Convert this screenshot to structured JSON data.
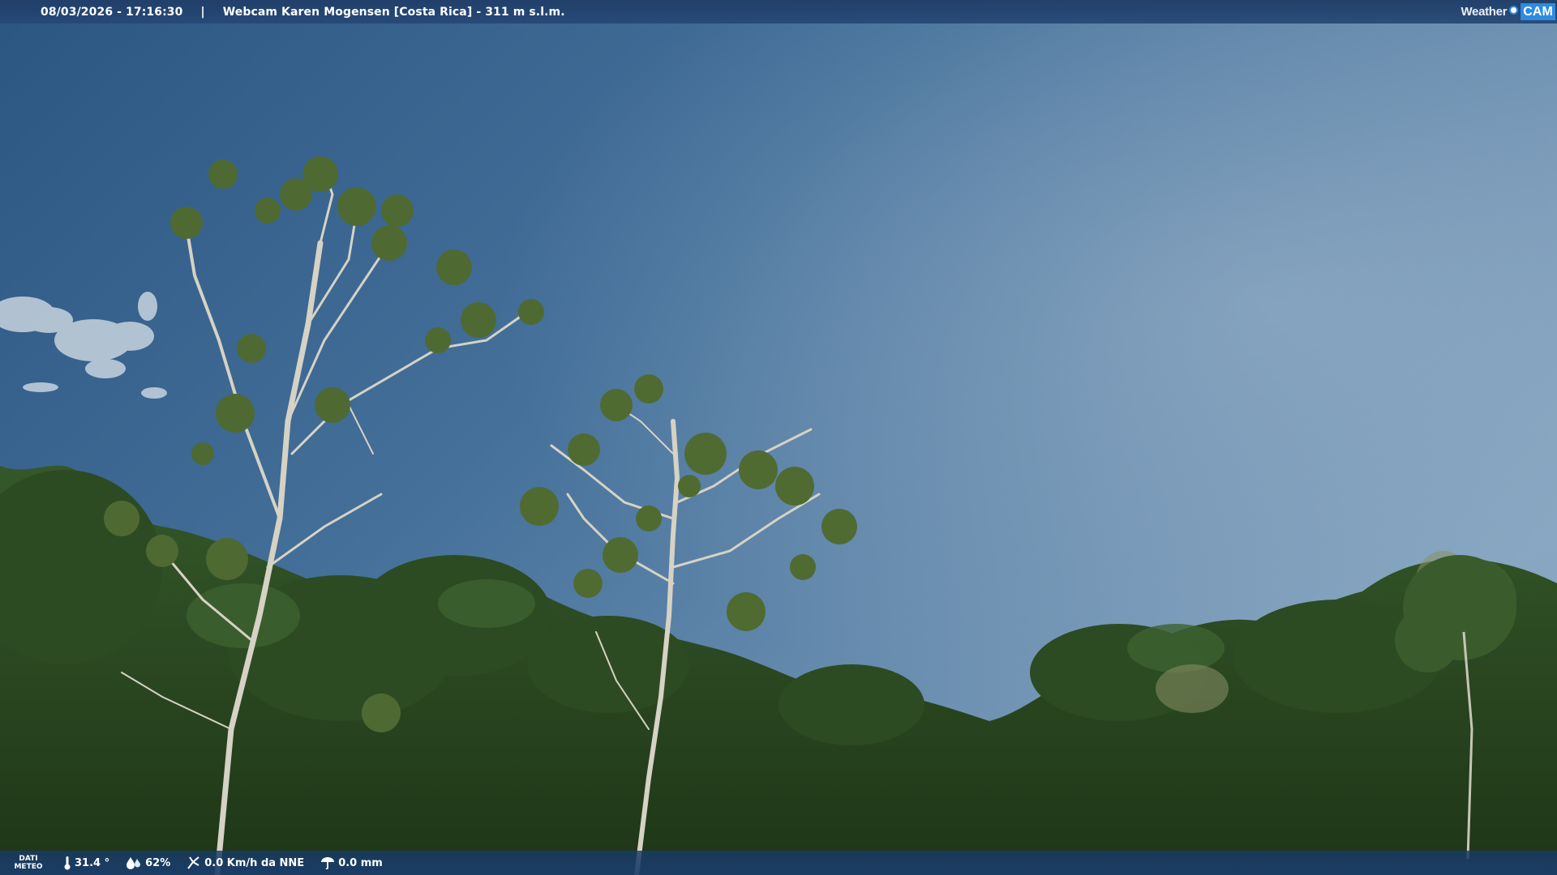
{
  "header": {
    "datetime": "08/03/2026 - 17:16:30",
    "separator": "|",
    "camera_title": "Webcam Karen Mogensen [Costa Rica] - 311 m s.l.m.",
    "logo_weather": "Weather",
    "logo_cam": "CAM"
  },
  "weather_bar": {
    "label_line1": "DATI",
    "label_line2": "METEO",
    "temperature": "31.4 °",
    "humidity": "62%",
    "wind": "0.0 Km/h da NNE",
    "rain": "0.0 mm"
  },
  "icons": {
    "temperature": "thermometer-icon",
    "humidity": "humidity-drop-icon",
    "wind": "wind-icon",
    "rain": "rain-gauge-icon"
  },
  "colors": {
    "bar_bg": "#234774",
    "logo_accent": "#2d8be0",
    "sky_top": "#2f5a86",
    "sky_right": "#7b9dbb",
    "foliage": "#2b4a20"
  }
}
